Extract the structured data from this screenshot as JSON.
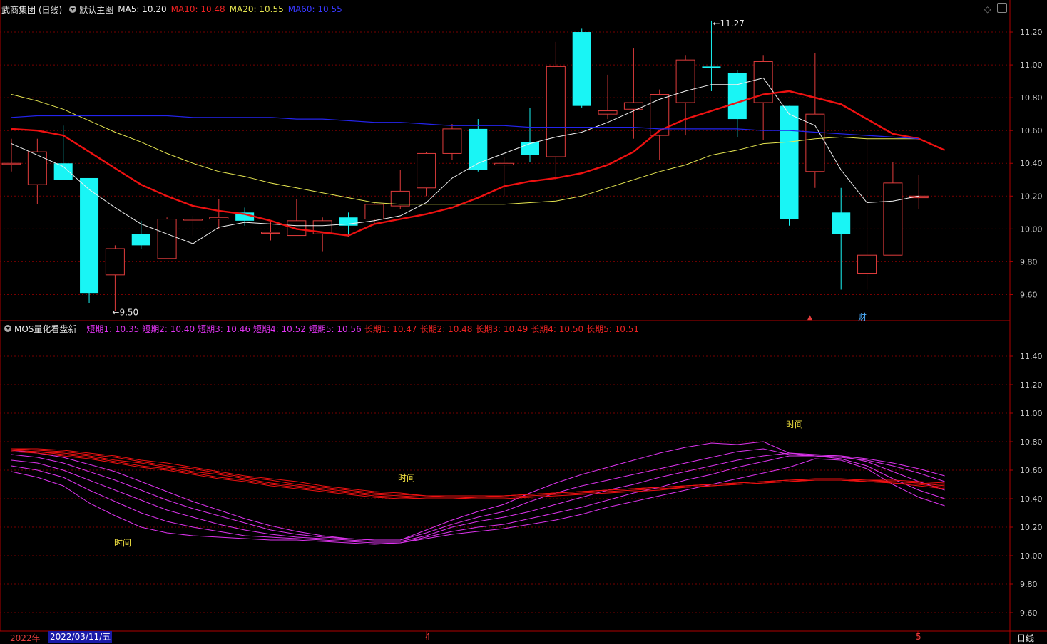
{
  "header": {
    "stock_name": "武商集团 (日线)",
    "main_chart_label": "默认主图",
    "ma5": "MA5: 10.20",
    "ma10": "MA10: 10.48",
    "ma20": "MA20: 10.55",
    "ma60": "MA60: 10.55"
  },
  "sub_header": {
    "indicator_name": "MOS量化看盘新",
    "short1": "短期1: 10.35",
    "short2": "短期2: 10.40",
    "short3": "短期3: 10.46",
    "short4": "短期4: 10.52",
    "short5": "短期5: 10.56",
    "long1": "长期1: 10.47",
    "long2": "长期2: 10.48",
    "long3": "长期3: 10.49",
    "long4": "长期4: 10.50",
    "long5": "长期5: 10.51"
  },
  "footer": {
    "year": "2022年",
    "cursor_date": "2022/03/11/五",
    "month_4": "4",
    "month_5": "5",
    "period": "日线"
  },
  "colors": {
    "up": "#e03c3c",
    "down": "#19f5f5",
    "ma5": "#f0f0f0",
    "ma10": "#ee1111",
    "ma20": "#e6e650",
    "ma60": "#2424ee",
    "short": "#dd33ee",
    "long": "#ee1111",
    "grid": "#7a0000",
    "axis": "#b00000"
  },
  "chart_data": [
    {
      "type": "candlestick",
      "title": "武商集团 (日线)",
      "ylim": [
        9.45,
        11.3
      ],
      "yticks": [
        "11.20",
        "11.00",
        "10.80",
        "10.60",
        "10.40",
        "10.20",
        "10.00",
        "9.80",
        "9.60"
      ],
      "annotations": {
        "high": "11.27",
        "low": "9.50",
        "marker_up": "▲",
        "marker_cai": "财"
      },
      "candles": [
        {
          "o": 10.4,
          "h": 10.55,
          "l": 10.35,
          "c": 10.4
        },
        {
          "o": 10.27,
          "h": 10.55,
          "l": 10.15,
          "c": 10.47
        },
        {
          "o": 10.4,
          "h": 10.63,
          "l": 10.3,
          "c": 10.3
        },
        {
          "o": 10.31,
          "h": 10.31,
          "l": 9.55,
          "c": 9.61
        },
        {
          "o": 9.72,
          "h": 9.9,
          "l": 9.5,
          "c": 9.88
        },
        {
          "o": 9.97,
          "h": 10.05,
          "l": 9.88,
          "c": 9.9
        },
        {
          "o": 9.82,
          "h": 10.07,
          "l": 9.82,
          "c": 10.06
        },
        {
          "o": 10.06,
          "h": 10.08,
          "l": 9.96,
          "c": 10.06
        },
        {
          "o": 10.06,
          "h": 10.18,
          "l": 10.0,
          "c": 10.07
        },
        {
          "o": 10.1,
          "h": 10.13,
          "l": 10.02,
          "c": 10.05
        },
        {
          "o": 9.98,
          "h": 10.05,
          "l": 9.93,
          "c": 9.98
        },
        {
          "o": 9.96,
          "h": 10.18,
          "l": 9.96,
          "c": 10.05
        },
        {
          "o": 9.97,
          "h": 10.07,
          "l": 9.86,
          "c": 10.05
        },
        {
          "o": 10.07,
          "h": 10.1,
          "l": 9.95,
          "c": 10.02
        },
        {
          "o": 10.06,
          "h": 10.16,
          "l": 10.03,
          "c": 10.15
        },
        {
          "o": 10.14,
          "h": 10.36,
          "l": 10.12,
          "c": 10.23
        },
        {
          "o": 10.25,
          "h": 10.47,
          "l": 10.2,
          "c": 10.46
        },
        {
          "o": 10.46,
          "h": 10.64,
          "l": 10.42,
          "c": 10.61
        },
        {
          "o": 10.61,
          "h": 10.67,
          "l": 10.35,
          "c": 10.36
        },
        {
          "o": 10.39,
          "h": 10.44,
          "l": 10.2,
          "c": 10.4
        },
        {
          "o": 10.53,
          "h": 10.74,
          "l": 10.41,
          "c": 10.45
        },
        {
          "o": 10.44,
          "h": 11.14,
          "l": 10.3,
          "c": 10.99
        },
        {
          "o": 11.2,
          "h": 11.22,
          "l": 10.74,
          "c": 10.75
        },
        {
          "o": 10.7,
          "h": 10.94,
          "l": 10.67,
          "c": 10.72
        },
        {
          "o": 10.73,
          "h": 11.1,
          "l": 10.55,
          "c": 10.77
        },
        {
          "o": 10.57,
          "h": 10.85,
          "l": 10.42,
          "c": 10.82
        },
        {
          "o": 10.77,
          "h": 11.06,
          "l": 10.57,
          "c": 11.03
        },
        {
          "o": 10.99,
          "h": 11.27,
          "l": 10.84,
          "c": 10.98
        },
        {
          "o": 10.95,
          "h": 10.97,
          "l": 10.56,
          "c": 10.67
        },
        {
          "o": 10.77,
          "h": 11.06,
          "l": 10.54,
          "c": 11.02
        },
        {
          "o": 10.75,
          "h": 10.75,
          "l": 10.02,
          "c": 10.06
        },
        {
          "o": 10.35,
          "h": 11.07,
          "l": 10.25,
          "c": 10.7
        },
        {
          "o": 10.1,
          "h": 10.25,
          "l": 9.63,
          "c": 9.97
        },
        {
          "o": 9.73,
          "h": 10.55,
          "l": 9.63,
          "c": 9.84
        },
        {
          "o": 9.84,
          "h": 10.41,
          "l": 9.84,
          "c": 10.28
        },
        {
          "o": 10.19,
          "h": 10.33,
          "l": 10.12,
          "c": 10.2
        }
      ],
      "series": [
        {
          "name": "MA5",
          "values": [
            10.52,
            10.45,
            10.38,
            10.24,
            10.13,
            10.03,
            9.97,
            9.91,
            10.01,
            10.04,
            10.03,
            10.02,
            10.02,
            10.03,
            10.05,
            10.08,
            10.16,
            10.31,
            10.4,
            10.46,
            10.52,
            10.56,
            10.59,
            10.65,
            10.72,
            10.79,
            10.84,
            10.88,
            10.88,
            10.92,
            10.7,
            10.63,
            10.36,
            10.16,
            10.17,
            10.2
          ]
        },
        {
          "name": "MA10",
          "values": [
            10.61,
            10.6,
            10.57,
            10.47,
            10.37,
            10.27,
            10.2,
            10.14,
            10.11,
            10.09,
            10.05,
            10.0,
            9.98,
            9.96,
            10.03,
            10.06,
            10.09,
            10.13,
            10.19,
            10.26,
            10.29,
            10.31,
            10.34,
            10.39,
            10.47,
            10.6,
            10.67,
            10.72,
            10.77,
            10.82,
            10.84,
            10.8,
            10.76,
            10.67,
            10.58,
            10.55,
            10.48
          ]
        },
        {
          "name": "MA20",
          "values": [
            10.82,
            10.78,
            10.73,
            10.66,
            10.59,
            10.53,
            10.46,
            10.4,
            10.35,
            10.32,
            10.28,
            10.25,
            10.22,
            10.19,
            10.16,
            10.15,
            10.15,
            10.15,
            10.15,
            10.15,
            10.16,
            10.17,
            10.2,
            10.25,
            10.3,
            10.35,
            10.39,
            10.45,
            10.48,
            10.52,
            10.53,
            10.55,
            10.56,
            10.55,
            10.55,
            10.55
          ]
        },
        {
          "name": "MA60",
          "values": [
            10.68,
            10.69,
            10.69,
            10.69,
            10.69,
            10.69,
            10.69,
            10.68,
            10.68,
            10.68,
            10.68,
            10.67,
            10.67,
            10.66,
            10.65,
            10.65,
            10.64,
            10.63,
            10.63,
            10.63,
            10.62,
            10.62,
            10.62,
            10.62,
            10.62,
            10.61,
            10.61,
            10.61,
            10.61,
            10.6,
            10.6,
            10.59,
            10.58,
            10.57,
            10.56,
            10.55
          ]
        }
      ]
    },
    {
      "type": "line",
      "title": "MOS量化看盘新",
      "ylim": [
        9.5,
        11.55
      ],
      "yticks": [
        "11.40",
        "11.20",
        "11.00",
        "10.80",
        "10.60",
        "10.40",
        "10.20",
        "10.00",
        "9.80",
        "9.60"
      ],
      "annotations": [
        "时间",
        "时间",
        "时间"
      ],
      "series": [
        {
          "name": "短期1",
          "values": [
            10.59,
            10.55,
            10.49,
            10.37,
            10.28,
            10.2,
            10.16,
            10.14,
            10.13,
            10.12,
            10.11,
            10.11,
            10.1,
            10.09,
            10.08,
            10.09,
            10.12,
            10.15,
            10.17,
            10.19,
            10.22,
            10.25,
            10.29,
            10.34,
            10.38,
            10.42,
            10.46,
            10.5,
            10.54,
            10.58,
            10.62,
            10.68,
            10.67,
            10.61,
            10.5,
            10.41,
            10.35
          ]
        },
        {
          "name": "短期2",
          "values": [
            10.63,
            10.6,
            10.55,
            10.46,
            10.38,
            10.3,
            10.24,
            10.2,
            10.17,
            10.14,
            10.13,
            10.12,
            10.11,
            10.1,
            10.09,
            10.09,
            10.13,
            10.17,
            10.2,
            10.22,
            10.26,
            10.3,
            10.34,
            10.39,
            10.44,
            10.48,
            10.53,
            10.57,
            10.62,
            10.66,
            10.7,
            10.7,
            10.68,
            10.63,
            10.54,
            10.46,
            10.4
          ]
        },
        {
          "name": "短期3",
          "values": [
            10.67,
            10.65,
            10.6,
            10.53,
            10.46,
            10.39,
            10.32,
            10.27,
            10.22,
            10.18,
            10.15,
            10.13,
            10.12,
            10.11,
            10.1,
            10.1,
            10.14,
            10.2,
            10.24,
            10.27,
            10.31,
            10.36,
            10.41,
            10.46,
            10.5,
            10.55,
            10.59,
            10.63,
            10.67,
            10.7,
            10.72,
            10.71,
            10.7,
            10.66,
            10.59,
            10.52,
            10.46
          ]
        },
        {
          "name": "短期4",
          "values": [
            10.71,
            10.69,
            10.65,
            10.59,
            10.53,
            10.46,
            10.39,
            10.33,
            10.28,
            10.23,
            10.18,
            10.15,
            10.13,
            10.12,
            10.11,
            10.11,
            10.16,
            10.22,
            10.27,
            10.31,
            10.38,
            10.44,
            10.49,
            10.53,
            10.57,
            10.61,
            10.65,
            10.69,
            10.73,
            10.75,
            10.71,
            10.7,
            10.69,
            10.67,
            10.63,
            10.58,
            10.52
          ]
        },
        {
          "name": "短期5",
          "values": [
            10.74,
            10.72,
            10.69,
            10.64,
            10.59,
            10.52,
            10.45,
            10.38,
            10.32,
            10.26,
            10.21,
            10.17,
            10.14,
            10.12,
            10.11,
            10.11,
            10.18,
            10.25,
            10.31,
            10.36,
            10.44,
            10.51,
            10.57,
            10.62,
            10.67,
            10.72,
            10.76,
            10.79,
            10.78,
            10.8,
            10.72,
            10.7,
            10.7,
            10.68,
            10.65,
            10.61,
            10.56
          ]
        },
        {
          "name": "长期1",
          "values": [
            10.73,
            10.72,
            10.7,
            10.68,
            10.65,
            10.62,
            10.6,
            10.57,
            10.54,
            10.52,
            10.49,
            10.47,
            10.45,
            10.43,
            10.41,
            10.4,
            10.4,
            10.4,
            10.4,
            10.4,
            10.41,
            10.42,
            10.43,
            10.44,
            10.45,
            10.46,
            10.48,
            10.49,
            10.5,
            10.51,
            10.52,
            10.53,
            10.53,
            10.52,
            10.51,
            10.49,
            10.47
          ]
        },
        {
          "name": "长期2",
          "values": [
            10.74,
            10.73,
            10.71,
            10.69,
            10.66,
            10.63,
            10.61,
            10.58,
            10.55,
            10.53,
            10.5,
            10.48,
            10.46,
            10.44,
            10.42,
            10.41,
            10.4,
            10.4,
            10.41,
            10.41,
            10.42,
            10.43,
            10.44,
            10.45,
            10.46,
            10.47,
            10.48,
            10.49,
            10.5,
            10.51,
            10.52,
            10.53,
            10.53,
            10.52,
            10.51,
            10.5,
            10.48
          ]
        },
        {
          "name": "长期3",
          "values": [
            10.74,
            10.73,
            10.72,
            10.7,
            10.67,
            10.65,
            10.62,
            10.59,
            10.57,
            10.54,
            10.51,
            10.49,
            10.47,
            10.45,
            10.43,
            10.42,
            10.41,
            10.41,
            10.41,
            10.42,
            10.43,
            10.44,
            10.45,
            10.46,
            10.47,
            10.48,
            10.49,
            10.5,
            10.51,
            10.52,
            10.53,
            10.53,
            10.53,
            10.52,
            10.52,
            10.51,
            10.49
          ]
        },
        {
          "name": "长期4",
          "values": [
            10.75,
            10.74,
            10.73,
            10.71,
            10.69,
            10.66,
            10.63,
            10.61,
            10.58,
            10.55,
            10.53,
            10.5,
            10.48,
            10.46,
            10.44,
            10.43,
            10.42,
            10.41,
            10.41,
            10.42,
            10.43,
            10.44,
            10.45,
            10.46,
            10.47,
            10.48,
            10.49,
            10.5,
            10.51,
            10.52,
            10.53,
            10.53,
            10.53,
            10.53,
            10.52,
            10.51,
            10.5
          ]
        },
        {
          "name": "长期5",
          "values": [
            10.75,
            10.75,
            10.74,
            10.72,
            10.7,
            10.67,
            10.65,
            10.62,
            10.59,
            10.56,
            10.54,
            10.52,
            10.49,
            10.47,
            10.45,
            10.44,
            10.42,
            10.42,
            10.42,
            10.42,
            10.43,
            10.44,
            10.45,
            10.46,
            10.47,
            10.48,
            10.49,
            10.5,
            10.51,
            10.52,
            10.53,
            10.54,
            10.54,
            10.53,
            10.53,
            10.52,
            10.51
          ]
        }
      ]
    }
  ]
}
